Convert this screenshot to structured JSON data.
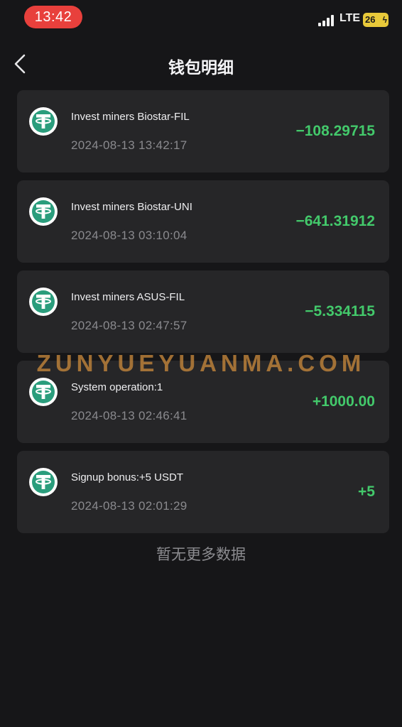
{
  "status_bar": {
    "time": "13:42",
    "network": "LTE",
    "battery": "26"
  },
  "header": {
    "title": "钱包明细",
    "back_icon": "chevron-left-icon"
  },
  "transactions": [
    {
      "title": "Invest miners Biostar-FIL",
      "datetime": "2024-08-13 13:42:17",
      "amount": "−108.29715",
      "icon": "tether-usdt-icon"
    },
    {
      "title": "Invest miners Biostar-UNI",
      "datetime": "2024-08-13 03:10:04",
      "amount": "−641.31912",
      "icon": "tether-usdt-icon"
    },
    {
      "title": "Invest miners ASUS-FIL",
      "datetime": "2024-08-13 02:47:57",
      "amount": "−5.334115",
      "icon": "tether-usdt-icon"
    },
    {
      "title": "System operation:1",
      "datetime": "2024-08-13 02:46:41",
      "amount": "+1000.00",
      "icon": "tether-usdt-icon"
    },
    {
      "title": "Signup bonus:+5 USDT",
      "datetime": "2024-08-13 02:01:29",
      "amount": "+5",
      "icon": "tether-usdt-icon"
    }
  ],
  "footer": {
    "no_more_text": "暂无更多数据"
  },
  "watermark": "ZUNYUEYUANMA.COM",
  "colors": {
    "background": "#161618",
    "card": "#262628",
    "amount": "#43c96b",
    "time_pill": "#e8403c",
    "tether": "#2a9d7c"
  }
}
